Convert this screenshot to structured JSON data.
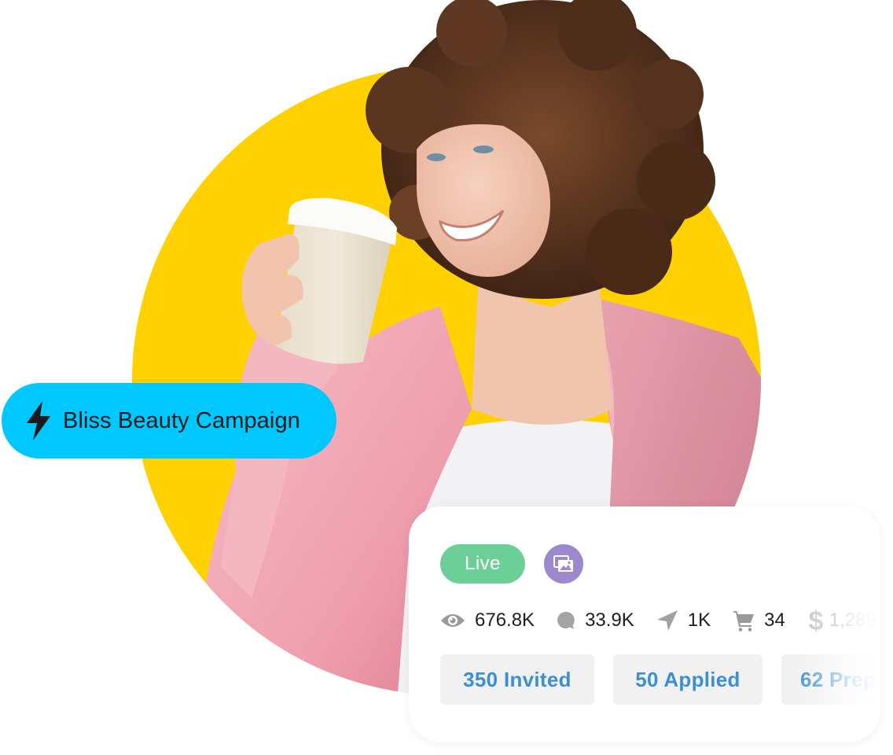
{
  "colors": {
    "yellow_circle": "#ffd100",
    "campaign_pill": "#00c8ff",
    "live_badge": "#6dcf98",
    "media_badge": "#9c88cc",
    "status_pill_bg": "#f1f1f1",
    "status_pill_text": "#3c8fd2",
    "jacket_pink": "#f2aebb"
  },
  "hero": {
    "subject": "smiling woman with curly hair in pink blazer holding paper coffee cup"
  },
  "campaign": {
    "icon": "lightning-bolt-icon",
    "name": "Bliss Beauty Campaign"
  },
  "card": {
    "status_badge": "Live",
    "media_icon": "image-gallery-icon",
    "stats": [
      {
        "icon": "eye-icon",
        "label": "views",
        "value": "676.8K"
      },
      {
        "icon": "comment-bubble-icon",
        "label": "comments",
        "value": "33.9K"
      },
      {
        "icon": "send-arrow-icon",
        "label": "shares",
        "value": "1K"
      },
      {
        "icon": "shopping-cart-icon",
        "label": "purchases",
        "value": "34"
      },
      {
        "icon": "dollar-icon",
        "label": "revenue",
        "value": "1,289"
      }
    ],
    "pipeline": [
      {
        "count": "350",
        "label": "Invited",
        "text": "350 Invited"
      },
      {
        "count": "50",
        "label": "Applied",
        "text": "50 Applied"
      },
      {
        "count": "62",
        "label": "Prep",
        "text": "62 Prep"
      }
    ]
  }
}
